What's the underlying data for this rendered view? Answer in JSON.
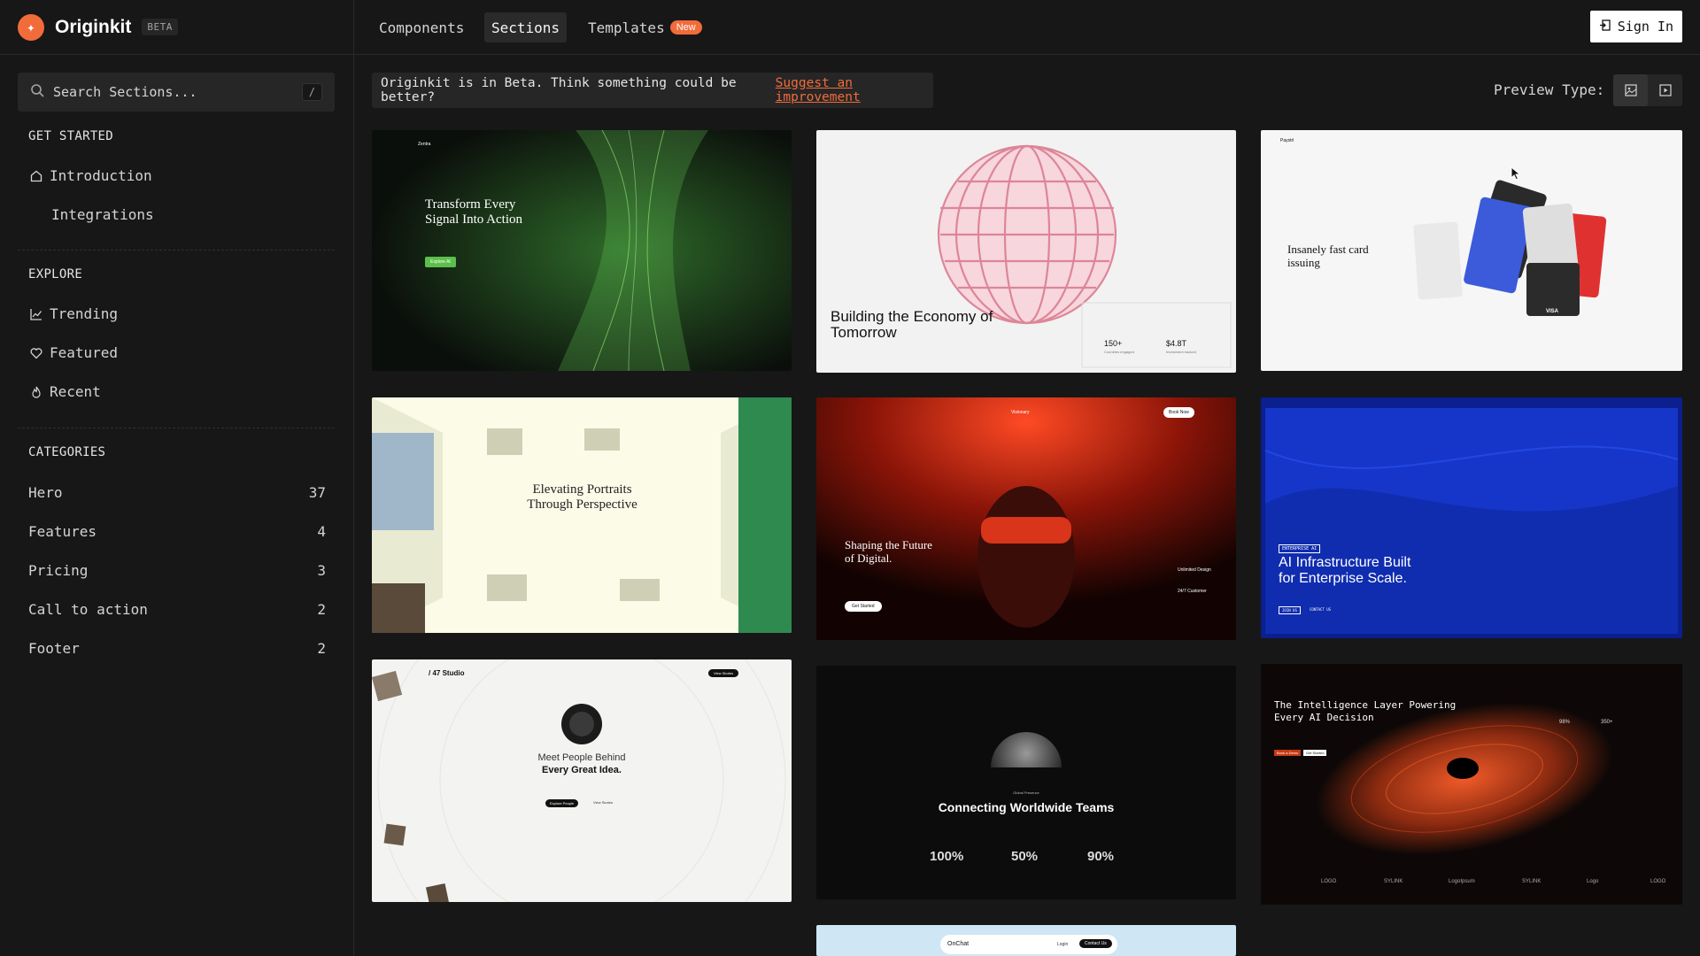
{
  "brand": {
    "name": "Originkit",
    "badge": "BETA"
  },
  "top_nav": {
    "tabs": [
      "Components",
      "Sections",
      "Templates"
    ],
    "active": "Sections",
    "new_badge": "New",
    "sign_in": "Sign In"
  },
  "search": {
    "placeholder": "Search Sections...",
    "shortcut": "/"
  },
  "sidebar": {
    "get_started": {
      "title": "GET STARTED",
      "items": [
        "Introduction",
        "Integrations"
      ]
    },
    "explore": {
      "title": "EXPLORE",
      "items": [
        {
          "label": "Trending",
          "icon": "trending-icon"
        },
        {
          "label": "Featured",
          "icon": "heart-icon"
        },
        {
          "label": "Recent",
          "icon": "flame-icon"
        }
      ]
    },
    "categories": {
      "title": "CATEGORIES",
      "items": [
        {
          "label": "Hero",
          "count": "37"
        },
        {
          "label": "Features",
          "count": "4"
        },
        {
          "label": "Pricing",
          "count": "3"
        },
        {
          "label": "Call to action",
          "count": "2"
        },
        {
          "label": "Footer",
          "count": "2"
        }
      ]
    }
  },
  "banner": {
    "text": "Originkit is in Beta. Think something could be better?",
    "link": "Suggest an improvement"
  },
  "preview": {
    "label": "Preview Type:",
    "options": [
      "image-icon",
      "video-icon"
    ],
    "selected": "image-icon"
  },
  "cards": [
    {
      "title": "Transform Every Signal Into Action",
      "brand": "Zentra",
      "cta": "Explore AI",
      "colors": {
        "bg": "#0b0f0b",
        "accent": "#5bbf4a"
      }
    },
    {
      "title": "Building the Economy of Tomorrow",
      "stat1": "150+",
      "stat1_label": "Countries engaged",
      "stat2": "$4.8T",
      "stat2_label": "Investment tracked",
      "colors": {
        "bg": "#f2f2f2",
        "accent": "#d9778c"
      }
    },
    {
      "title": "Insanely fast card issuing",
      "brand": "Paystrl",
      "card_label": "VISA",
      "colors": {
        "bg": "#f6f6f6"
      }
    },
    {
      "title": "Elevating Portraits Through Perspective",
      "colors": {
        "bg": "#fbfbe8",
        "accent": "#2f8a4f"
      }
    },
    {
      "title": "Shaping the Future of Digital.",
      "brand": "Visionary",
      "cta": "Get Started",
      "book": "Book Now",
      "right1": "Unlimited Design",
      "right2": "24/7 Customer",
      "colors": {
        "bg": "#1a0504",
        "accent": "#e0361c"
      }
    },
    {
      "title": "AI Infrastructure Built for Enterprise Scale.",
      "tag": "ENTERPRISE AI",
      "cta": "JOIN US",
      "cta2": "CONTACT US",
      "colors": {
        "bg": "#0b1f8f"
      }
    },
    {
      "title": "Every Great Idea.",
      "pre": "Meet People Behind",
      "brand": "/ 47 Studio",
      "cta": "Explore People",
      "cta2": "View Stories",
      "nav_cta": "View Stories",
      "colors": {
        "bg": "#f3f3f1"
      }
    },
    {
      "title": "Connecting Worldwide Teams",
      "tag": "Global Presence",
      "stats": [
        "100%",
        "50%",
        "90%"
      ],
      "colors": {
        "bg": "#0c0c0c"
      }
    },
    {
      "title": "The Intelligence Layer Powering Every AI Decision",
      "stat1": "98%",
      "stat2": "350+",
      "cta": "Book a Demo",
      "cta2": "Get Started",
      "logos": [
        "LOGO",
        "SYLINK",
        "LogoIpsum",
        "SYLINK",
        "Logo",
        "LOGO"
      ],
      "colors": {
        "bg": "#0d0807",
        "accent": "#c63a14"
      }
    },
    {
      "brand": "OnChat",
      "login": "Login",
      "contact": "Contact Us",
      "colors": {
        "bg": "#cfe6f5"
      }
    }
  ]
}
